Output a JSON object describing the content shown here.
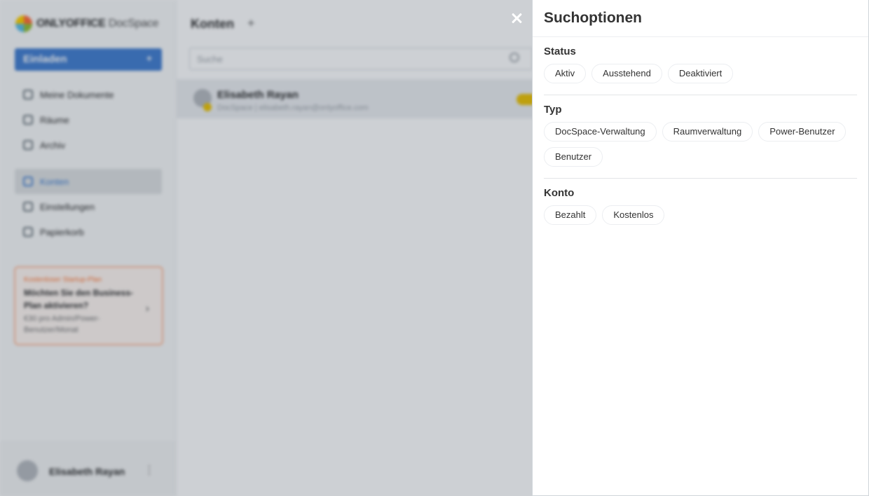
{
  "background": {
    "logo": {
      "brand": "ONLYOFFICE",
      "product": "DocSpace"
    },
    "invite_label": "Einladen",
    "nav_items": [
      {
        "label": "Meine Dokumente",
        "icon": "user-icon"
      },
      {
        "label": "Räume",
        "icon": "folder-icon"
      },
      {
        "label": "Archiv",
        "icon": "archive-icon"
      },
      {
        "label": "Konten",
        "icon": "accounts-icon",
        "active": true
      },
      {
        "label": "Einstellungen",
        "icon": "gear-icon"
      },
      {
        "label": "Papierkorb",
        "icon": "trash-icon"
      }
    ],
    "promo": {
      "tag": "Kostenloser Startup-Plan",
      "title": "Möchten Sie den Business-Plan aktivieren?",
      "subtitle": "€30 pro Admin/Power-Benutzer/Monat"
    },
    "profile_name": "Elisabeth Rayan",
    "main_title": "Konten",
    "search_placeholder": "Suche",
    "user_row": {
      "name": "Elisabeth Rayan",
      "meta": "DocSpace | elisabeth.rayan@onlyoffice.com"
    }
  },
  "panel": {
    "title": "Suchoptionen",
    "sections": [
      {
        "title": "Status",
        "options": [
          "Aktiv",
          "Ausstehend",
          "Deaktiviert"
        ]
      },
      {
        "title": "Typ",
        "options": [
          "DocSpace-Verwaltung",
          "Raumverwaltung",
          "Power-Benutzer",
          "Benutzer"
        ]
      },
      {
        "title": "Konto",
        "options": [
          "Bezahlt",
          "Kostenlos"
        ]
      }
    ]
  },
  "colors": {
    "accent": "#4781d1",
    "overlay": "#061626",
    "chip_border": "#eceef1",
    "promo_border": "#ffb997"
  }
}
